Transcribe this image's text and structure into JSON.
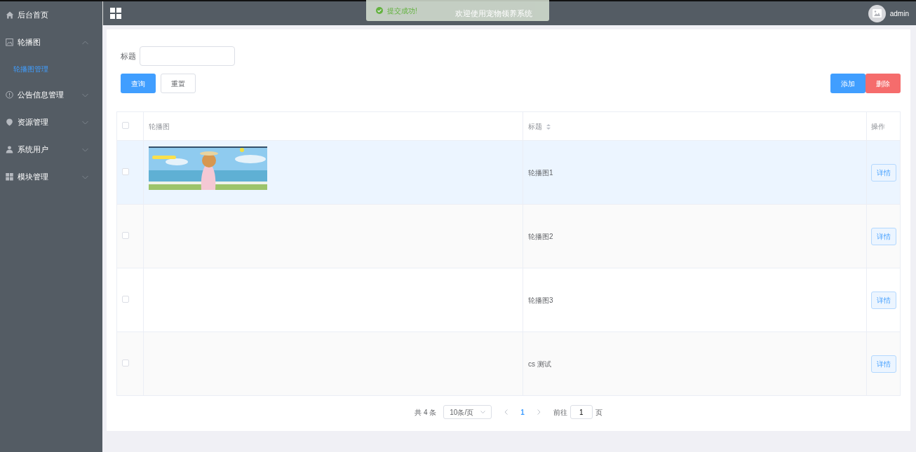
{
  "sidebar": {
    "items": [
      {
        "label": "后台首页"
      },
      {
        "label": "轮播图",
        "expanded": true,
        "children": [
          {
            "label": "轮播图管理",
            "selected": true
          }
        ]
      },
      {
        "label": "公告信息管理",
        "expanded": false
      },
      {
        "label": "资源管理",
        "expanded": false
      },
      {
        "label": "系统用户",
        "expanded": false
      },
      {
        "label": "模块管理",
        "expanded": false
      }
    ]
  },
  "header": {
    "title": "欢迎使用宠物领养系统",
    "user": "admin"
  },
  "toast": {
    "message": "提交成功!"
  },
  "search": {
    "label": "标题",
    "query_button": "查询",
    "reset_button": "重置"
  },
  "actions": {
    "add_button": "添加",
    "delete_button": "删除"
  },
  "table": {
    "select_all": {
      "checked": false
    },
    "columns": [
      {
        "label": "轮播图",
        "sortable": false
      },
      {
        "label": "标题",
        "sortable": true
      },
      {
        "label": "操作",
        "sortable": false
      }
    ],
    "rows": [
      {
        "checked": false,
        "hovered": true,
        "title": "轮播图1",
        "action": "详情"
      },
      {
        "checked": false,
        "hovered": false,
        "title": "轮播图2",
        "action": "详情"
      },
      {
        "checked": false,
        "hovered": false,
        "title": "轮播图3",
        "action": "详情"
      },
      {
        "checked": false,
        "hovered": false,
        "title": "cs 测试",
        "action": "详情"
      }
    ]
  },
  "pagination": {
    "total": "共 4 条",
    "page_size": "10条/页",
    "pages": [
      {
        "label": "1",
        "selected": true
      }
    ],
    "goto_label": "前往",
    "goto_value": "1",
    "page_suffix": "页"
  }
}
